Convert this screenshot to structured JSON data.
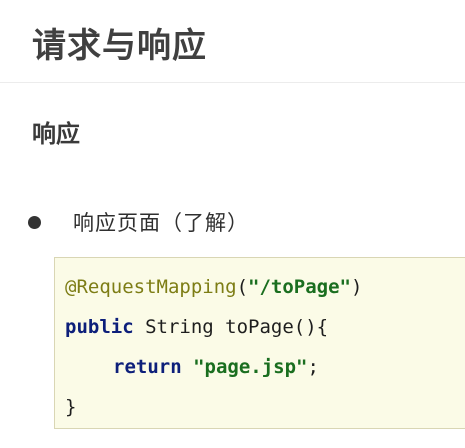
{
  "page": {
    "title": "请求与响应",
    "section_heading": "响应",
    "bullet_text": "响应页面（了解）"
  },
  "code": {
    "line1": {
      "annotation": "@RequestMapping",
      "open": "(",
      "string": "\"/toPage\"",
      "close": ")"
    },
    "line2": {
      "keyword": "public",
      "rest": " String toPage(){"
    },
    "line3": {
      "keyword": "return",
      "space": " ",
      "string": "\"page.jsp\"",
      "end": ";"
    },
    "line4": {
      "text": "}"
    }
  },
  "colors": {
    "code_background": "#fbfbe7",
    "keyword": "#0d1f7a",
    "string": "#1a6e1f",
    "annotation": "#7d7d15"
  }
}
